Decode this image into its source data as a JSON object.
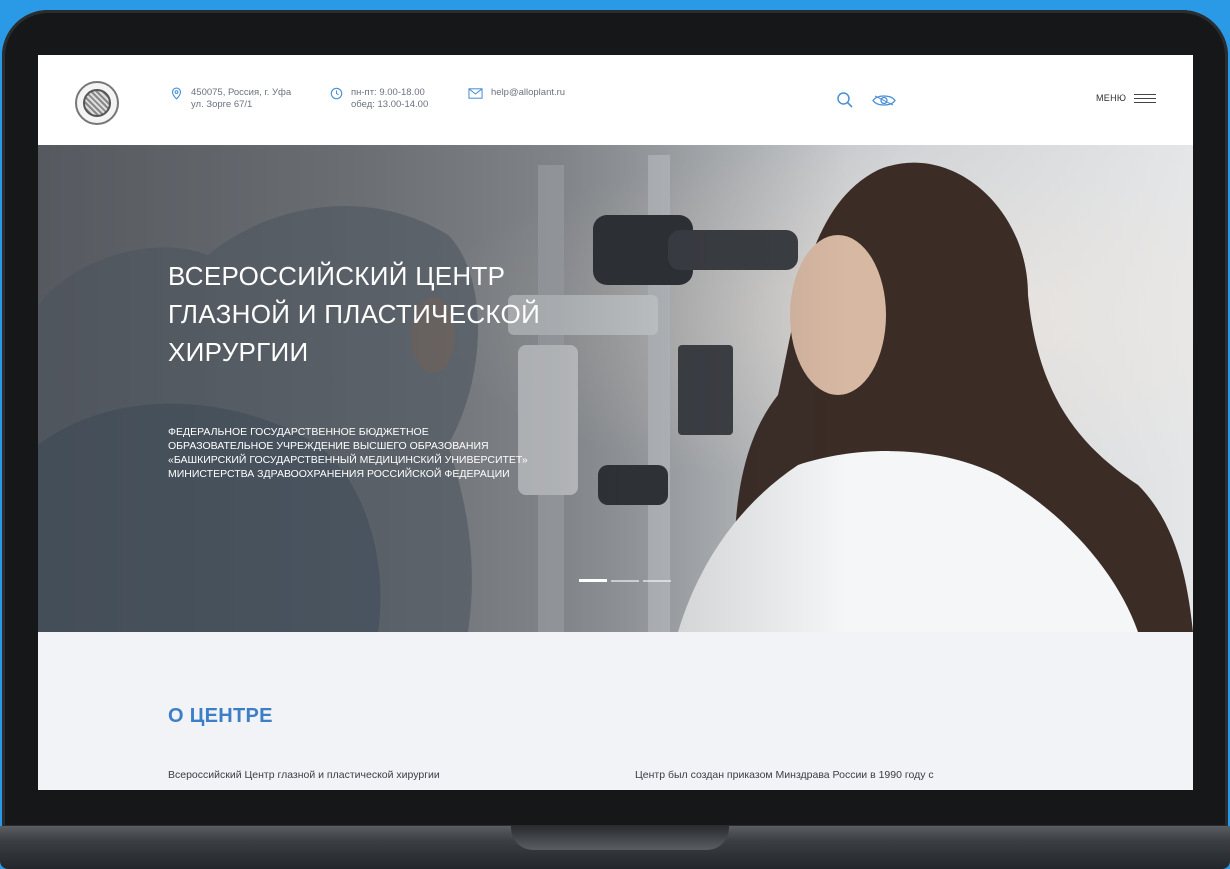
{
  "header": {
    "address_line1": "450075, Россия, г. Уфа",
    "address_line2": "ул. Зорге 67/1",
    "hours_line1": "пн-пт: 9.00-18.00",
    "hours_line2": "обед: 13.00-14.00",
    "email": "help@alloplant.ru",
    "menu_label": "МЕНЮ"
  },
  "hero": {
    "title_lines": [
      "ВСЕРОССИЙСКИЙ ЦЕНТР",
      "ГЛАЗНОЙ И ПЛАСТИЧЕСКОЙ",
      "ХИРУРГИИ"
    ],
    "subtitle_lines": [
      "ФЕДЕРАЛЬНОЕ ГОСУДАРСТВЕННОЕ БЮДЖЕТНОЕ",
      "ОБРАЗОВАТЕЛЬНОЕ УЧРЕЖДЕНИЕ ВЫСШЕГО ОБРАЗОВАНИЯ",
      "«БАШКИРСКИЙ ГОСУДАРСТВЕННЫЙ МЕДИЦИНСКИЙ УНИВЕРСИТЕТ»",
      "МИНИСТЕРСТВА ЗДРАВООХРАНЕНИЯ РОССИЙСКОЙ ФЕДЕРАЦИИ"
    ],
    "slides_total": 3,
    "slide_active": 1
  },
  "about": {
    "title": "О ЦЕНТРЕ",
    "col1_text": "Всероссийский Центр глазной и пластической хирургии",
    "col2_text": "Центр был создан приказом Минздрава России в 1990 году с"
  },
  "colors": {
    "background": "#2b9ae6",
    "accent": "#3d7fc6",
    "icon": "#4a8fd6"
  },
  "icons": {
    "location": "location-pin-icon",
    "hours": "clock-icon",
    "email": "mail-icon",
    "search": "search-icon",
    "visually_impaired": "eye-icon",
    "menu": "hamburger-icon"
  }
}
